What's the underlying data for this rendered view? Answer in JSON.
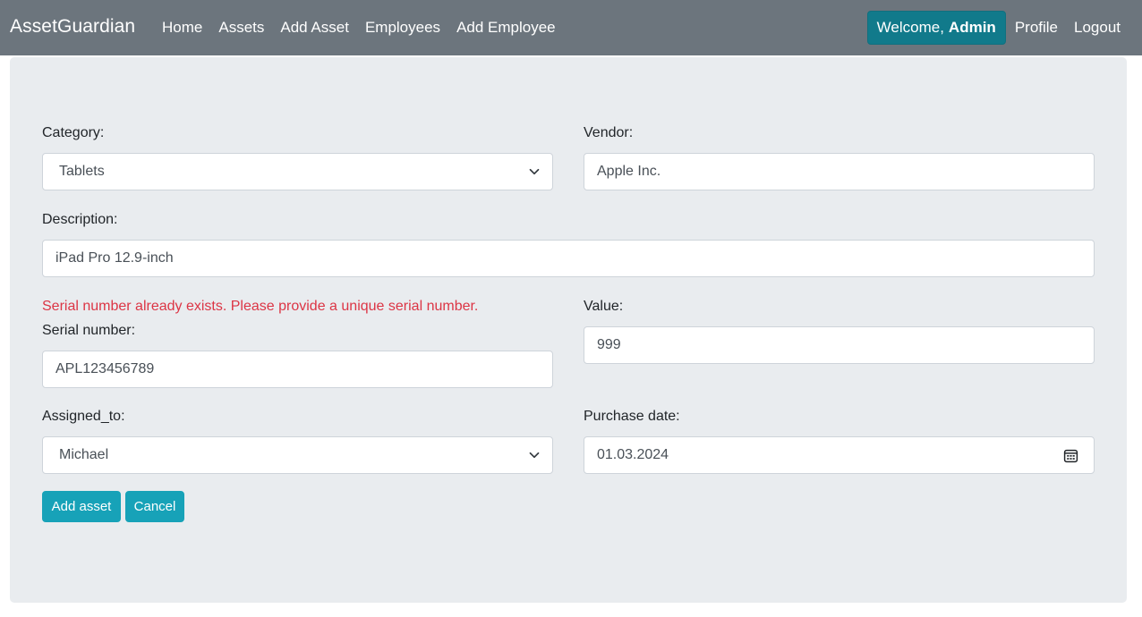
{
  "nav": {
    "brand": "AssetGuardian",
    "links": [
      "Home",
      "Assets",
      "Add Asset",
      "Employees",
      "Add Employee"
    ],
    "welcome_prefix": "Welcome,",
    "welcome_user": "Admin",
    "profile": "Profile",
    "logout": "Logout"
  },
  "form": {
    "category_label": "Category:",
    "category_value": "Tablets",
    "vendor_label": "Vendor:",
    "vendor_value": "Apple Inc.",
    "description_label": "Description:",
    "description_value": "iPad Pro 12.9-inch",
    "serial_error": "Serial number already exists. Please provide a unique serial number.",
    "serial_label": "Serial number:",
    "serial_value": "APL123456789",
    "value_label": "Value:",
    "value_value": "999",
    "assigned_label": "Assigned_to:",
    "assigned_value": "Michael",
    "purchase_label": "Purchase date:",
    "purchase_value": "01.03.2024",
    "add_button": "Add asset",
    "cancel_button": "Cancel"
  },
  "icons": {
    "select_chevron": "chevron-down-icon",
    "date_picker": "calendar-icon"
  },
  "colors": {
    "navbar": "#6c757d",
    "welcome_bg": "#117a8b",
    "panel": "#e9ecef",
    "error": "#dc3545",
    "button": "#17a2b8"
  }
}
